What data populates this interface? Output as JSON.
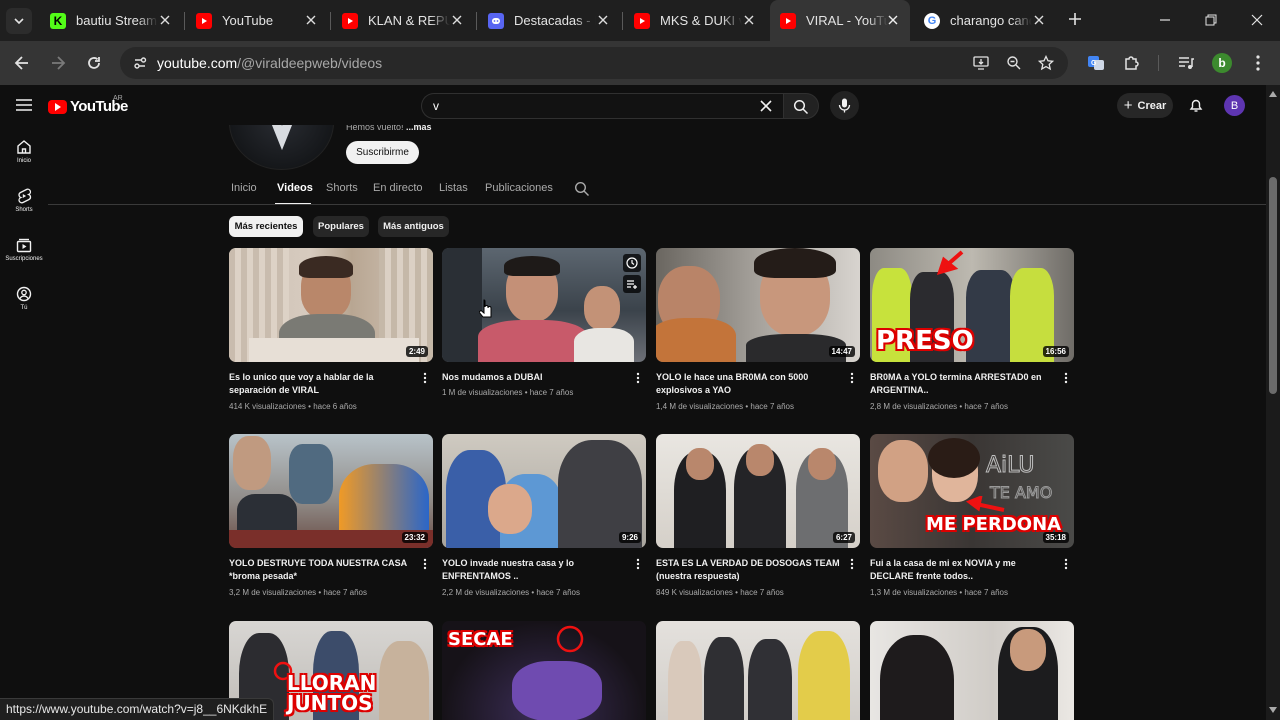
{
  "browser": {
    "tabs": [
      {
        "title": "bautiu Stream",
        "favicon": "kick-icon",
        "color": "#53fc18"
      },
      {
        "title": "YouTube",
        "favicon": "youtube-icon",
        "color": "#ff0000"
      },
      {
        "title": "KLAN & REPUBLICA",
        "favicon": "youtube-icon",
        "color": "#ff0000"
      },
      {
        "title": "Destacadas - Descargas",
        "favicon": "discord-icon",
        "color": "#5865f2"
      },
      {
        "title": "MKS & DUKI vs",
        "favicon": "youtube-icon",
        "color": "#ff0000"
      },
      {
        "title": "VIRAL - YouTube",
        "favicon": "youtube-icon",
        "color": "#ff0000",
        "active": true
      },
      {
        "title": "charango cancion",
        "favicon": "google-icon",
        "color": "#4285f4"
      }
    ],
    "url_host": "youtube.com",
    "url_path": "/@viraldeepweb/videos",
    "profile_initial": "b",
    "status_url": "https://www.youtube.com/watch?v=j8__6NKdkhE"
  },
  "youtube": {
    "logo_text": "YouTube",
    "country_code": "AR",
    "search_query": "v",
    "create_label": "Crear",
    "avatar_initial": "B",
    "guide": [
      {
        "label": "Inicio",
        "icon": "home-icon"
      },
      {
        "label": "Shorts",
        "icon": "shorts-icon"
      },
      {
        "label": "Suscripciones",
        "icon": "subscriptions-icon"
      },
      {
        "label": "Tú",
        "icon": "you-icon"
      }
    ],
    "channel": {
      "description": "Hemos vuelto! ",
      "more_label": "...más",
      "subscribe_label": "Suscribirme",
      "tabs": [
        "Inicio",
        "Videos",
        "Shorts",
        "En directo",
        "Listas",
        "Publicaciones"
      ],
      "active_tab": "Videos"
    },
    "chips": [
      {
        "label": "Más recientes",
        "selected": true
      },
      {
        "label": "Populares",
        "selected": false
      },
      {
        "label": "Más antiguos",
        "selected": false
      }
    ],
    "videos": [
      {
        "title": "Es lo unico que voy a hablar de la separación de VIRAL",
        "views": "414 K visualizaciones",
        "age": "hace 6 años",
        "duration": "2:49"
      },
      {
        "title": "Nos mudamos a DUBAI",
        "views": "1 M de visualizaciones",
        "age": "hace 7 años",
        "duration": ""
      },
      {
        "title": "YOLO le hace una BR0MA con 5000 explosivos a YAO",
        "views": "1,4 M de visualizaciones",
        "age": "hace 7 años",
        "duration": "14:47"
      },
      {
        "title": "BR0MA a YOLO termina ARRESTAD0 en ARGENTINA..",
        "views": "2,8 M de visualizaciones",
        "age": "hace 7 años",
        "duration": "16:56",
        "overlay": "PRESO"
      },
      {
        "title": "YOLO DESTRUYE TODA NUESTRA CASA *broma pesada*",
        "views": "3,2 M de visualizaciones",
        "age": "hace 7 años",
        "duration": "23:32"
      },
      {
        "title": "YOLO invade nuestra casa y lo ENFRENTAMOS ..",
        "views": "2,2 M de visualizaciones",
        "age": "hace 7 años",
        "duration": "9:26"
      },
      {
        "title": "ESTA ES LA VERDAD DE DOSOGAS TEAM (nuestra respuesta)",
        "views": "849 K visualizaciones",
        "age": "hace 7 años",
        "duration": "6:27"
      },
      {
        "title": "Fui a la casa de mi ex NOVIA y me DECLARE frente todos..",
        "views": "1,3 M de visualizaciones",
        "age": "hace 7 años",
        "duration": "35:18",
        "overlay": "ME PERDONA"
      },
      {
        "title": "",
        "views": "",
        "age": "",
        "duration": "",
        "overlay": "LLORAN JUNTOS"
      },
      {
        "title": "",
        "views": "",
        "age": "",
        "duration": "",
        "overlay": "SECAE"
      },
      {
        "title": "",
        "views": "",
        "age": "",
        "duration": ""
      },
      {
        "title": "",
        "views": "",
        "age": "",
        "duration": ""
      }
    ]
  },
  "colors": {
    "accent": "#ff0000",
    "background": "#0f0f0f",
    "chip": "#272727"
  }
}
